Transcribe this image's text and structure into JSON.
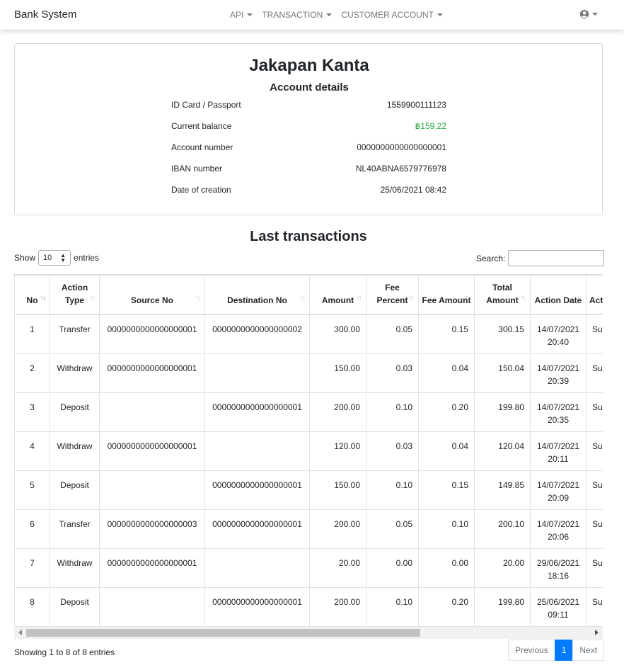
{
  "navbar": {
    "brand": "Bank System",
    "links": [
      {
        "label": "API"
      },
      {
        "label": "TRANSACTION"
      },
      {
        "label": "CUSTOMER ACCOUNT"
      }
    ],
    "user_icon": "user-circle-icon"
  },
  "account": {
    "holder_name": "Jakapan Kanta",
    "heading": "Account details",
    "details": [
      {
        "label": "ID Card / Passport",
        "value": "1559900111123"
      },
      {
        "label": "Current balance",
        "value": "฿159.22"
      },
      {
        "label": "Account number",
        "value": "0000000000000000001"
      },
      {
        "label": "IBAN number",
        "value": "NL40ABNA6579776978"
      },
      {
        "label": "Date of creation",
        "value": "25/06/2021 08:42"
      }
    ],
    "balance_color": "#28a745"
  },
  "transactions": {
    "heading": "Last transactions",
    "show_label": "Show",
    "entries_label": "entries",
    "page_length": "10",
    "search_label": "Search:",
    "search_value": "",
    "columns": [
      "No",
      "Action Type",
      "Source No",
      "Destination No",
      "Amount",
      "Fee Percent",
      "Fee Amount",
      "Total Amount",
      "Action Date",
      "Action Status"
    ],
    "rows": [
      {
        "no": "1",
        "type": "Transfer",
        "source": "0000000000000000001",
        "dest": "0000000000000000002",
        "amount": "300.00",
        "fee_percent": "0.05",
        "fee_amount": "0.15",
        "total": "300.15",
        "date": "14/07/2021 20:40",
        "status": "Success"
      },
      {
        "no": "2",
        "type": "Withdraw",
        "source": "0000000000000000001",
        "dest": "",
        "amount": "150.00",
        "fee_percent": "0.03",
        "fee_amount": "0.04",
        "total": "150.04",
        "date": "14/07/2021 20:39",
        "status": "Success"
      },
      {
        "no": "3",
        "type": "Deposit",
        "source": "",
        "dest": "0000000000000000001",
        "amount": "200.00",
        "fee_percent": "0.10",
        "fee_amount": "0.20",
        "total": "199.80",
        "date": "14/07/2021 20:35",
        "status": "Success"
      },
      {
        "no": "4",
        "type": "Withdraw",
        "source": "0000000000000000001",
        "dest": "",
        "amount": "120.00",
        "fee_percent": "0.03",
        "fee_amount": "0.04",
        "total": "120.04",
        "date": "14/07/2021 20:11",
        "status": "Success"
      },
      {
        "no": "5",
        "type": "Deposit",
        "source": "",
        "dest": "0000000000000000001",
        "amount": "150.00",
        "fee_percent": "0.10",
        "fee_amount": "0.15",
        "total": "149.85",
        "date": "14/07/2021 20:09",
        "status": "Success"
      },
      {
        "no": "6",
        "type": "Transfer",
        "source": "0000000000000000003",
        "dest": "0000000000000000001",
        "amount": "200.00",
        "fee_percent": "0.05",
        "fee_amount": "0.10",
        "total": "200.10",
        "date": "14/07/2021 20:06",
        "status": "Success"
      },
      {
        "no": "7",
        "type": "Withdraw",
        "source": "0000000000000000001",
        "dest": "",
        "amount": "20.00",
        "fee_percent": "0.00",
        "fee_amount": "0.00",
        "total": "20.00",
        "date": "29/06/2021 18:16",
        "status": "Success"
      },
      {
        "no": "8",
        "type": "Deposit",
        "source": "",
        "dest": "0000000000000000001",
        "amount": "200.00",
        "fee_percent": "0.10",
        "fee_amount": "0.20",
        "total": "199.80",
        "date": "25/06/2021 09:11",
        "status": "Success"
      }
    ],
    "info": "Showing 1 to 8 of 8 entries",
    "pagination": {
      "previous": "Previous",
      "current": "1",
      "next": "Next"
    },
    "accent_color": "#007bff"
  }
}
